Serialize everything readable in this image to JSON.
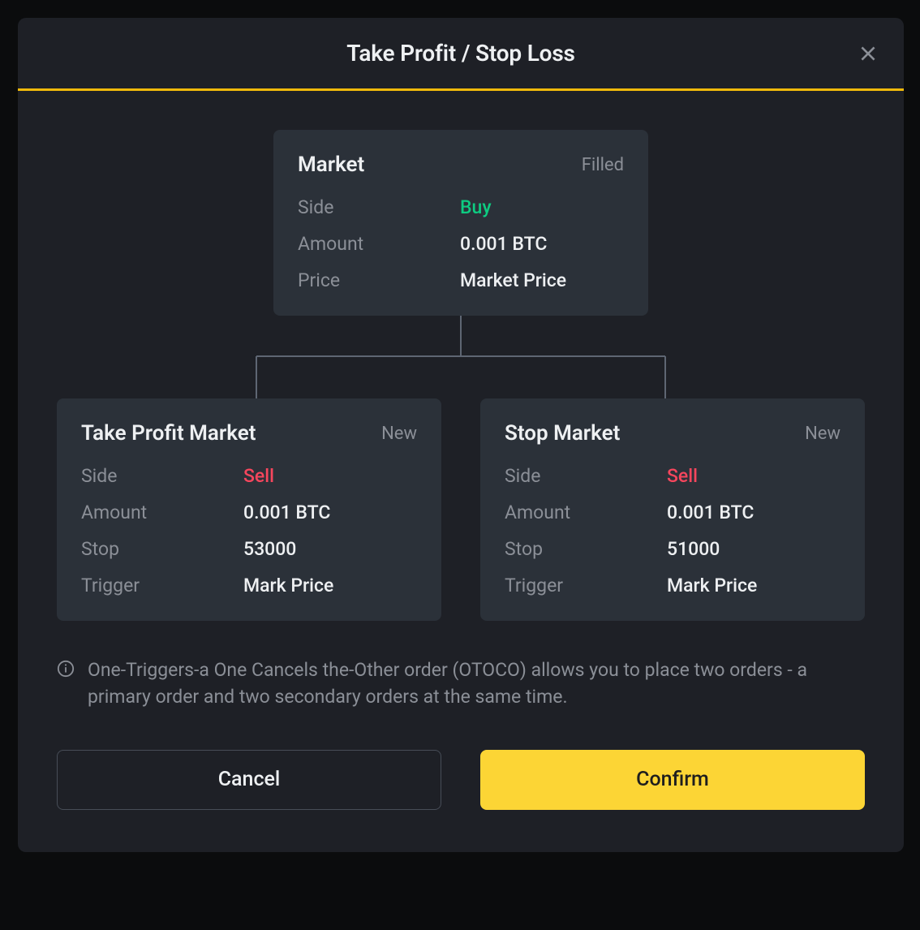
{
  "modal": {
    "title": "Take Profit / Stop Loss"
  },
  "market": {
    "title": "Market",
    "status": "Filled",
    "labels": {
      "side": "Side",
      "amount": "Amount",
      "price": "Price"
    },
    "values": {
      "side": "Buy",
      "amount": "0.001 BTC",
      "price": "Market Price"
    }
  },
  "tp": {
    "title": "Take Profit Market",
    "status": "New",
    "labels": {
      "side": "Side",
      "amount": "Amount",
      "stop": "Stop",
      "trigger": "Trigger"
    },
    "values": {
      "side": "Sell",
      "amount": "0.001 BTC",
      "stop": "53000",
      "trigger": "Mark Price"
    }
  },
  "sl": {
    "title": "Stop Market",
    "status": "New",
    "labels": {
      "side": "Side",
      "amount": "Amount",
      "stop": "Stop",
      "trigger": "Trigger"
    },
    "values": {
      "side": "Sell",
      "amount": "0.001 BTC",
      "stop": "51000",
      "trigger": "Mark Price"
    }
  },
  "info": {
    "text": "One-Triggers-a One Cancels the-Other order (OTOCO) allows you to place two orders - a primary order and two secondary orders at the same time."
  },
  "buttons": {
    "cancel": "Cancel",
    "confirm": "Confirm"
  }
}
